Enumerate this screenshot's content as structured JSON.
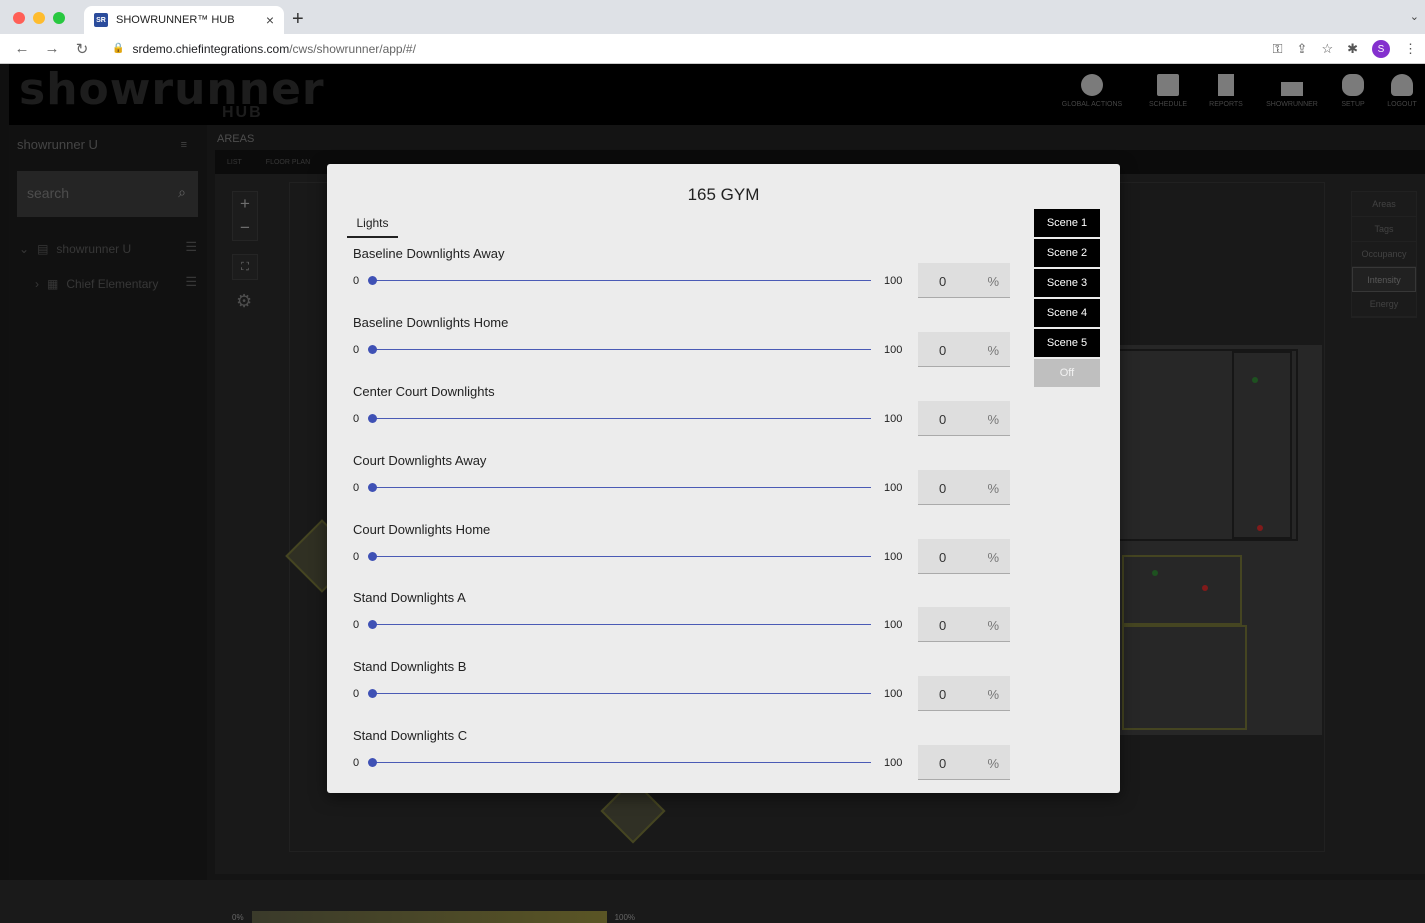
{
  "browser": {
    "tab_title": "SHOWRUNNER™ HUB",
    "tab_favicon": "SR",
    "url_host": "srdemo.chiefintegrations.com",
    "url_path": "/cws/showrunner/app/#/",
    "profile_initial": "S"
  },
  "header": {
    "logo": "showrunner",
    "logo_sub": "HUB",
    "nav": [
      {
        "label": "GLOBAL ACTIONS",
        "icon": "globe-icon"
      },
      {
        "label": "SCHEDULE",
        "icon": "calendar-icon"
      },
      {
        "label": "REPORTS",
        "icon": "clipboard-icon"
      },
      {
        "label": "SHOWRUNNER",
        "icon": "monitor-icon"
      },
      {
        "label": "SETUP",
        "icon": "gear-icon"
      },
      {
        "label": "LOGOUT",
        "icon": "user-icon"
      }
    ]
  },
  "sidebar": {
    "title": "showrunner U",
    "search_placeholder": "search",
    "tree": [
      {
        "label": "showrunner U"
      },
      {
        "label": "Chief Elementary"
      }
    ]
  },
  "main": {
    "areas_label": "AREAS",
    "subtabs": [
      "LIST",
      "FLOOR PLAN"
    ],
    "right_list": [
      "Areas",
      "Tags",
      "Occupancy",
      "Intensity",
      "Energy"
    ],
    "right_list_selected": "Intensity",
    "scale_min": "0%",
    "scale_max": "100%"
  },
  "modal": {
    "title": "165 GYM",
    "tab": "Lights",
    "percent_sign": "%",
    "lights": [
      {
        "name": "Baseline Downlights Away",
        "min": "0",
        "max": "100",
        "value": "0"
      },
      {
        "name": "Baseline Downlights Home",
        "min": "0",
        "max": "100",
        "value": "0"
      },
      {
        "name": "Center Court Downlights",
        "min": "0",
        "max": "100",
        "value": "0"
      },
      {
        "name": "Court Downlights Away",
        "min": "0",
        "max": "100",
        "value": "0"
      },
      {
        "name": "Court Downlights Home",
        "min": "0",
        "max": "100",
        "value": "0"
      },
      {
        "name": "Stand Downlights A",
        "min": "0",
        "max": "100",
        "value": "0"
      },
      {
        "name": "Stand Downlights B",
        "min": "0",
        "max": "100",
        "value": "0"
      },
      {
        "name": "Stand Downlights C",
        "min": "0",
        "max": "100",
        "value": "0"
      }
    ],
    "scenes": [
      "Scene 1",
      "Scene 2",
      "Scene 3",
      "Scene 4",
      "Scene 5"
    ],
    "off_label": "Off"
  }
}
